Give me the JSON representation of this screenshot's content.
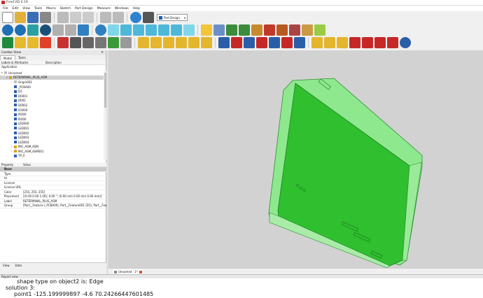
{
  "title": "FreeCAD 0.19",
  "menu": [
    "File",
    "Edit",
    "View",
    "Tools",
    "Macro",
    "Sketch",
    "Part Design",
    "Measure",
    "Windows",
    "Help"
  ],
  "workbench": "Part Design",
  "combo": {
    "title": "Combo View",
    "tabs": [
      "Model",
      "Tasks"
    ],
    "cols": [
      "Labels & Attributes",
      "Description"
    ],
    "section": "Application",
    "tree": [
      {
        "label": "Unnamed",
        "ind": 0,
        "t": "doc",
        "arrow": "▾"
      },
      {
        "label": "RETERMINAL_PLUS_ASM",
        "ind": 1,
        "t": "part",
        "arrow": "▾",
        "sel": true
      },
      {
        "label": "Origin003",
        "ind": 2,
        "t": "doc",
        "arrow": "›"
      },
      {
        "label": "_PCBA00",
        "ind": 2,
        "t": "cube"
      },
      {
        "label": "D1",
        "ind": 2,
        "t": "cube"
      },
      {
        "label": "D0001",
        "ind": 2,
        "t": "cube"
      },
      {
        "label": "D002",
        "ind": 2,
        "t": "cube"
      },
      {
        "label": "D0002",
        "ind": 2,
        "t": "cube"
      },
      {
        "label": "D3000",
        "ind": 2,
        "t": "cube"
      },
      {
        "label": "IR000",
        "ind": 2,
        "t": "cube"
      },
      {
        "label": "IR000",
        "ind": 2,
        "t": "cube"
      },
      {
        "label": "LED000",
        "ind": 2,
        "t": "cube"
      },
      {
        "label": "LED001",
        "ind": 2,
        "t": "cube"
      },
      {
        "label": "LED002",
        "ind": 2,
        "t": "cube"
      },
      {
        "label": "LED003",
        "ind": 2,
        "t": "cube"
      },
      {
        "label": "LED004",
        "ind": 2,
        "t": "cube"
      },
      {
        "label": "MIC_ASM_ASM",
        "ind": 2,
        "t": "part",
        "arrow": "›"
      },
      {
        "label": "MIC_ASM_ASM001",
        "ind": 2,
        "t": "part",
        "arrow": "›"
      },
      {
        "label": "TP_0",
        "ind": 2,
        "t": "cube"
      }
    ],
    "props_cols": [
      "Property",
      "Value"
    ],
    "props": [
      {
        "k": "Base",
        "v": "",
        "grp": true
      },
      {
        "k": "Type",
        "v": ""
      },
      {
        "k": "Id",
        "v": ""
      },
      {
        "k": "License",
        "v": ""
      },
      {
        "k": "License URL",
        "v": ""
      },
      {
        "k": "Color",
        "v": "[255, 255, 255]"
      },
      {
        "k": "Placement",
        "v": "[(0.00 0.00 1.00); 0.00 °; (0.00 mm  0.00 mm  0.00 mm)]"
      },
      {
        "k": "Label",
        "v": "RETERMINAL_PLUS_ASM"
      },
      {
        "k": "Group",
        "v": "[Part__Feature (_PCBA00), Part__Feature001 (D1), Part__Feature00..."
      }
    ],
    "bottom_tabs": [
      "View",
      "Data"
    ]
  },
  "doc_tab": "Unnamed : 1*",
  "report_title": "Report view",
  "report": [
    "shape type on object2 is: Edge",
    "solution 3:",
    "point1 -125.199999897    -4.6    70.24266447601485"
  ],
  "colors": {
    "green": "#2fbf2f",
    "green_light": "#8ee88e",
    "accent": "#1e5fb0"
  }
}
